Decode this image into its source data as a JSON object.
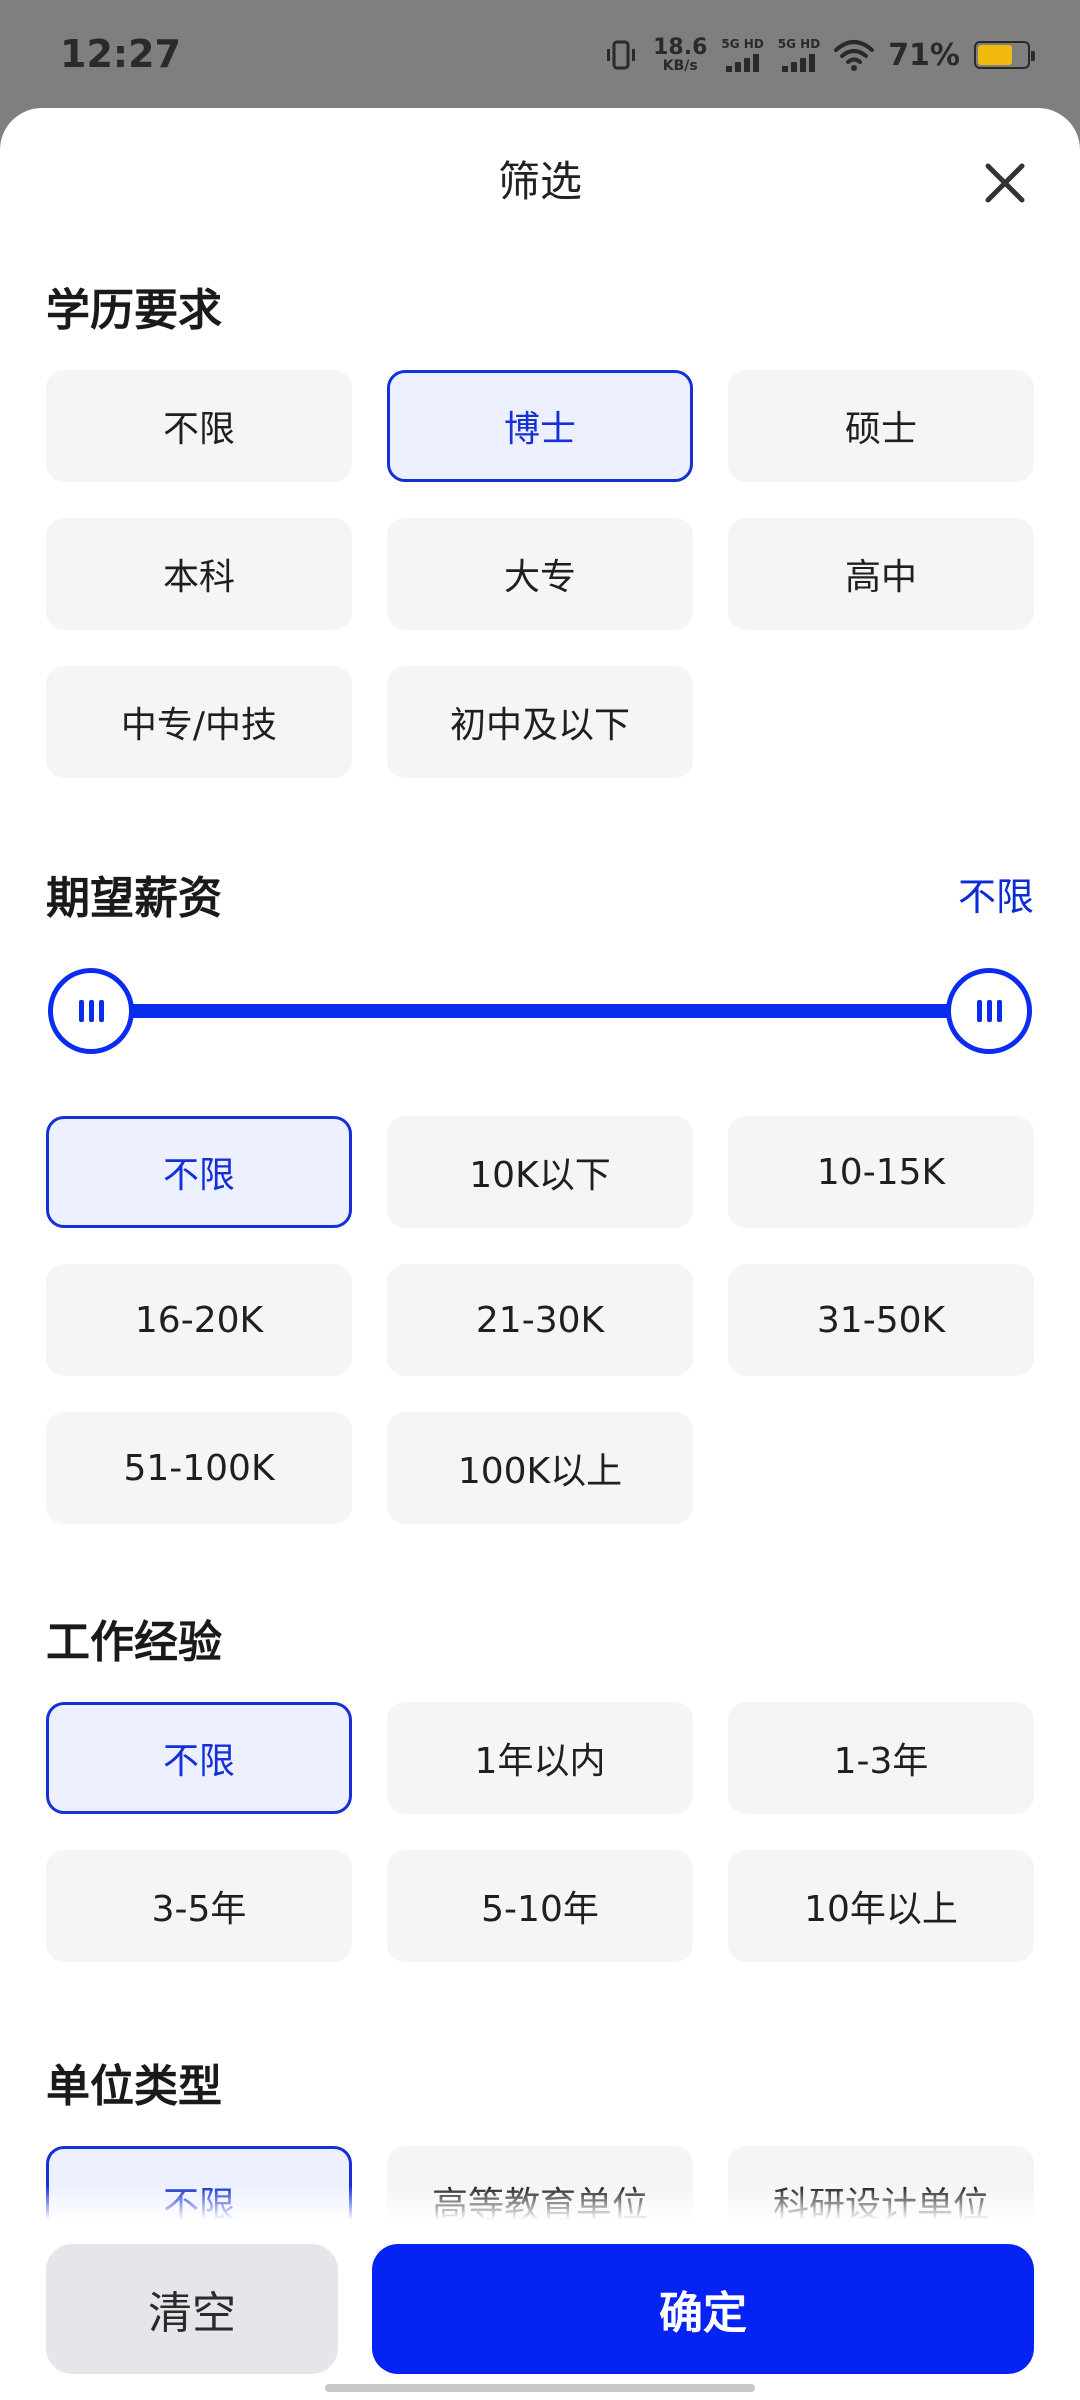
{
  "status": {
    "time": "12:27",
    "speed_value": "18.6",
    "speed_unit": "KB/s",
    "net1": "5G HD",
    "net2": "5G HD",
    "battery": "71%"
  },
  "sheet": {
    "title": "筛选"
  },
  "education": {
    "title": "学历要求",
    "options": [
      "不限",
      "博士",
      "硕士",
      "本科",
      "大专",
      "高中",
      "中专/中技",
      "初中及以下"
    ],
    "selected": "博士"
  },
  "salary": {
    "title": "期望薪资",
    "value_label": "不限",
    "options": [
      "不限",
      "10K以下",
      "10-15K",
      "16-20K",
      "21-30K",
      "31-50K",
      "51-100K",
      "100K以上"
    ],
    "selected": "不限",
    "slider_range": [
      0,
      1
    ]
  },
  "experience": {
    "title": "工作经验",
    "options": [
      "不限",
      "1年以内",
      "1-3年",
      "3-5年",
      "5-10年",
      "10年以上"
    ],
    "selected": "不限"
  },
  "unit_type": {
    "title": "单位类型",
    "options": [
      "不限",
      "高等教育单位",
      "科研设计单位"
    ],
    "selected": "不限"
  },
  "actions": {
    "clear": "清空",
    "confirm": "确定"
  },
  "colors": {
    "accent": "#0623f5",
    "selected_bg": "#edf0ff",
    "chip_bg": "#f5f5f6"
  },
  "icons": {
    "close": "close-icon",
    "slider_handle": "slider-handle-icon"
  }
}
